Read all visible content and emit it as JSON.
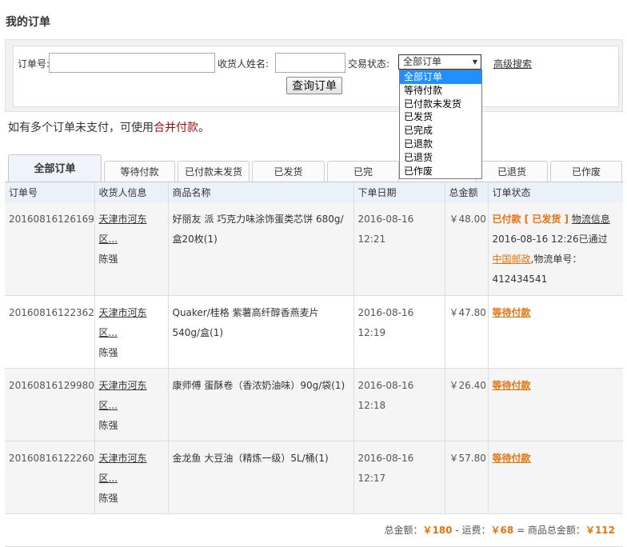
{
  "page_title": "我的订单",
  "search": {
    "order_no_label": "订单号:",
    "order_no_value": "",
    "receiver_label": "收货人姓名:",
    "receiver_value": "",
    "status_label": "交易状态:",
    "status_selected": "全部订单",
    "advanced_link": "高级搜索",
    "query_button": "查询订单",
    "status_options": [
      "全部订单",
      "等待付款",
      "已付款未发货",
      "已发货",
      "已完成",
      "已退款",
      "已退货",
      "已作废"
    ]
  },
  "notice": {
    "prefix": "如有多个订单未支付，可使用",
    "link": "合并付款",
    "suffix": "。"
  },
  "tabs": [
    "全部订单",
    "等待付款",
    "已付款未发货",
    "已发货",
    "已完",
    "已退货",
    "已作废"
  ],
  "table": {
    "headers": [
      "订单号",
      "收货人信息",
      "商品名称",
      "下单日期",
      "总金额",
      "订单状态"
    ],
    "rows": [
      {
        "order_no": "20160816126169",
        "addr": "天津市河东区...",
        "name": "陈强",
        "product": "好丽友 派 巧克力味涂饰蛋类芯饼 680g/盒20枚(1)",
        "date": "2016-08-16 12:21",
        "amount": "￥48.00",
        "status_main": "已付款 [ 已发货 ]",
        "status_link": "物流信息",
        "status_time": "2016-08-16 12:26已通过",
        "carrier": "中国邮政",
        "tracking_prefix": ",物流单号：",
        "tracking_no": "412434541"
      },
      {
        "order_no": "20160816122362",
        "addr": "天津市河东区...",
        "name": "陈强",
        "product": "Quaker/桂格 紫薯高纤醇香燕麦片 540g/盒(1)",
        "date": "2016-08-16 12:19",
        "amount": "￥47.80",
        "status": "等待付款"
      },
      {
        "order_no": "20160816129980",
        "addr": "天津市河东区...",
        "name": "陈强",
        "product": "康师傅 蛋酥卷（香浓奶油味）90g/袋(1)",
        "date": "2016-08-16 12:18",
        "amount": "￥26.40",
        "status": "等待付款"
      },
      {
        "order_no": "20160816122260",
        "addr": "天津市河东区...",
        "name": "陈强",
        "product": "金龙鱼 大豆油（精炼一级）5L/桶(1)",
        "date": "2016-08-16 12:17",
        "amount": "￥57.80",
        "status": "等待付款"
      }
    ]
  },
  "totals": {
    "total_label": "总金额：",
    "total": "￥180",
    "freight_label": "- 运费：",
    "freight": "￥68",
    "goods_label": "= 商品总金额：",
    "goods": "￥112"
  },
  "colors": {
    "accent": "#e8730c",
    "notice_link": "#a30f0f",
    "header_bg": "#eaf1f8",
    "dropdown_selected": "#1e90ff"
  }
}
